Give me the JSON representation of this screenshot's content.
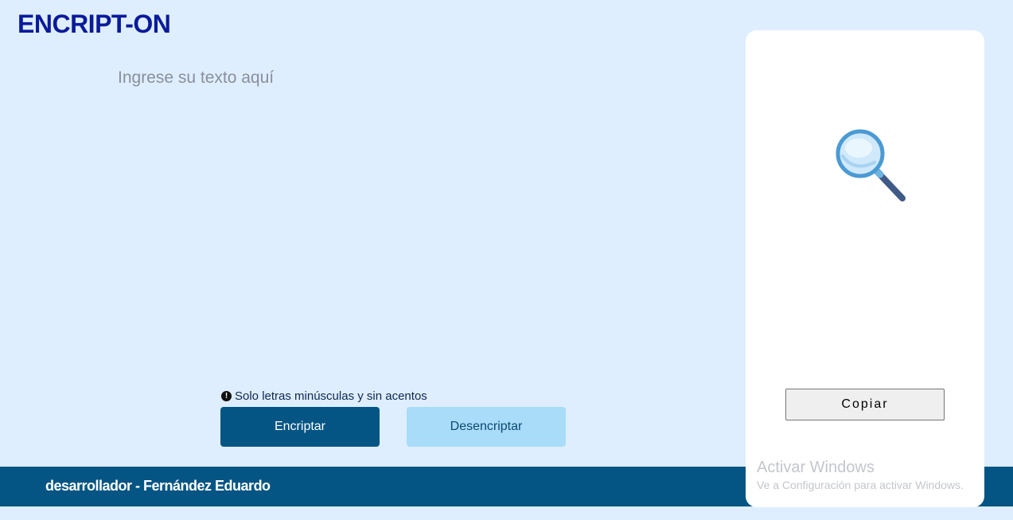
{
  "header": {
    "logo": "ENCRIPT-ON"
  },
  "input": {
    "placeholder": "Ingrese su texto aquí",
    "value": ""
  },
  "hint": {
    "text": "Solo letras minúsculas y sin acentos",
    "icon": "exclamation-circle-icon"
  },
  "buttons": {
    "encrypt_label": "Encriptar",
    "decrypt_label": "Desencriptar",
    "copy_label": "Copiar"
  },
  "output": {
    "icon": "magnifier-icon"
  },
  "footer": {
    "text": "desarrollador - Fernández Eduardo"
  },
  "watermark": {
    "title": "Activar Windows",
    "subtitle": "Ve a Configuración para activar Windows."
  },
  "colors": {
    "background": "#deeeff",
    "logo": "#0a1a9a",
    "primary": "#045584",
    "secondary": "#a9dcf8",
    "panel": "#ffffff"
  }
}
